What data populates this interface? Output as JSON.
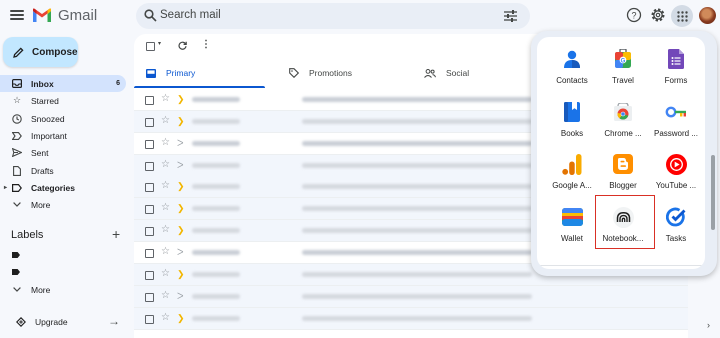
{
  "header": {
    "app_name": "Gmail",
    "search_placeholder": "Search mail"
  },
  "sidebar": {
    "compose_label": "Compose",
    "items": [
      {
        "label": "Inbox",
        "count": "6",
        "icon": "inbox-icon"
      },
      {
        "label": "Starred",
        "icon": "star-icon"
      },
      {
        "label": "Snoozed",
        "icon": "clock-icon"
      },
      {
        "label": "Important",
        "icon": "important-icon"
      },
      {
        "label": "Sent",
        "icon": "send-icon"
      },
      {
        "label": "Drafts",
        "icon": "draft-icon"
      },
      {
        "label": "Categories",
        "icon": "label-icon"
      },
      {
        "label": "More",
        "icon": "chevron-down-icon"
      }
    ],
    "labels_title": "Labels",
    "labels_more": "More",
    "upgrade_label": "Upgrade"
  },
  "tabs": [
    {
      "label": "Primary"
    },
    {
      "label": "Promotions"
    },
    {
      "label": "Social"
    }
  ],
  "apps": [
    {
      "label": "Contacts",
      "icon": "contacts-icon"
    },
    {
      "label": "Travel",
      "icon": "travel-icon"
    },
    {
      "label": "Forms",
      "icon": "forms-icon"
    },
    {
      "label": "Books",
      "icon": "books-icon"
    },
    {
      "label": "Chrome ...",
      "icon": "chrome-icon"
    },
    {
      "label": "Password ...",
      "icon": "password-icon"
    },
    {
      "label": "Google A...",
      "icon": "analytics-icon"
    },
    {
      "label": "Blogger",
      "icon": "blogger-icon"
    },
    {
      "label": "YouTube ...",
      "icon": "youtube-icon"
    },
    {
      "label": "Wallet",
      "icon": "wallet-icon"
    },
    {
      "label": "Notebook...",
      "icon": "notebooklm-icon"
    },
    {
      "label": "Tasks",
      "icon": "tasks-icon"
    }
  ],
  "colors": {
    "accent": "#0b57d0",
    "compose_bg": "#c2e7ff",
    "highlight": "#d93025"
  }
}
